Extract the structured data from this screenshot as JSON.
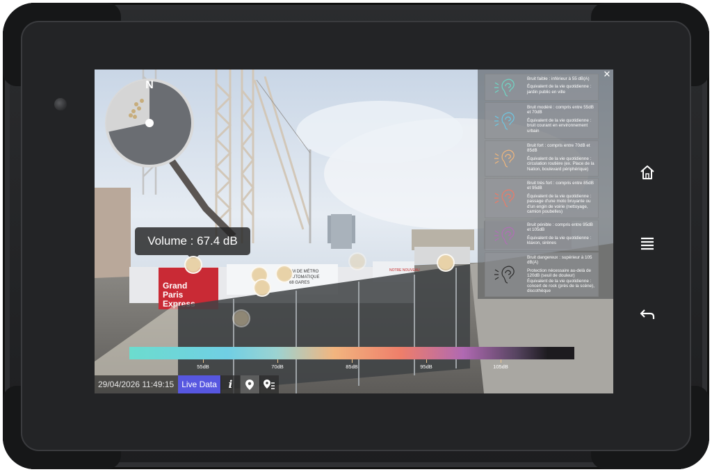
{
  "volume": {
    "label": "Volume : 67.4 dB"
  },
  "compass": {
    "north": "N"
  },
  "legend": {
    "close_icon": "close-icon",
    "items": [
      {
        "range": "Bruit faible : inférieur à 55 dB(A)",
        "desc": "Équivalent de la vie quotidienne : jardin public en ville",
        "color": "#6fd8c6"
      },
      {
        "range": "Bruit modéré : compris entre 55dB et 70dB",
        "desc": "Équivalent de la vie quotidienne : bruit courant en environnement urbain",
        "color": "#6cc8e4"
      },
      {
        "range": "Bruit fort : compris entre 70dB et 85dB",
        "desc": "Équivalent de la vie quotidienne : circulation routière (ex. Place de la Nation, boulevard périphérique)",
        "color": "#f2b67c"
      },
      {
        "range": "Bruit très fort : compris entre 85dB et 95dB",
        "desc": "Équivalent de la vie quotidienne : passage d'une moto bruyante ou d'un engin de voirie (nettoyage, camion poubelles)",
        "color": "#ee7a66"
      },
      {
        "range": "Bruit pénible : compris entre 95dB et 105dB",
        "desc": "Équivalent de la vie quotidienne : klaxon, sirènes",
        "color": "#b36cb8"
      },
      {
        "range": "Bruit dangereux : supérieur à 105 dB(A)",
        "desc": "Protection nécessaire au-delà de 120dB (seuil de douleur) Équivalent de la vie quotidienne : concert de rock (près de la scène), discothèque",
        "color": "#2a2a2a"
      }
    ]
  },
  "scale": {
    "ticks": [
      {
        "label": "55dB",
        "value": 55
      },
      {
        "label": "70dB",
        "value": 70
      },
      {
        "label": "85dB",
        "value": 85
      },
      {
        "label": "95dB",
        "value": 95
      },
      {
        "label": "105dB",
        "value": 105
      }
    ]
  },
  "photo_signs": {
    "sign1_line1": "Grand",
    "sign1_line2": "Paris",
    "sign1_line3": "Express",
    "sign2_line1": "KM DE MÉTRO",
    "sign2_line2": "AUTOMATIQUE",
    "sign2_line3": "68 GARES",
    "sign3": "NOTRE NOUVEAU"
  },
  "toolbar": {
    "timestamp": "29/04/2026 11:49:15",
    "live_label": "Live Data",
    "info_glyph": "i",
    "buttons": [
      "info-icon",
      "map-pin-icon",
      "pin-list-icon"
    ]
  },
  "hardware": {
    "buttons": [
      "home-icon",
      "menu-icon",
      "back-icon"
    ]
  }
}
